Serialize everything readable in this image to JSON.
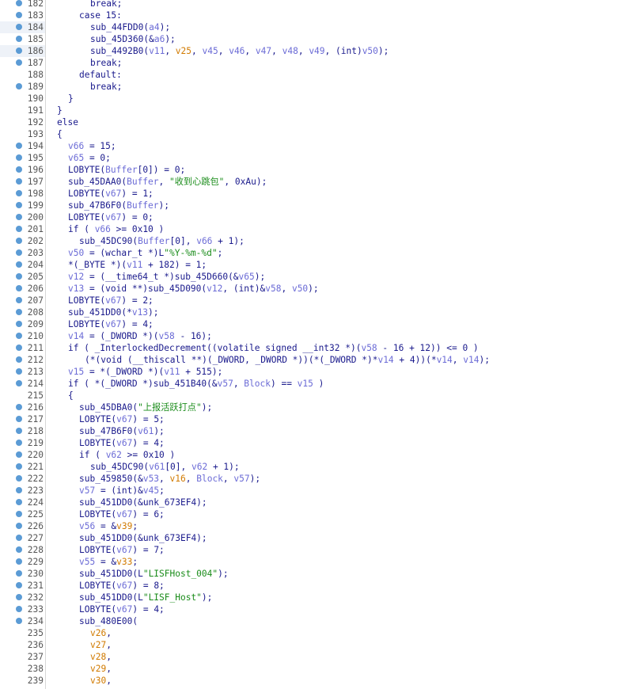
{
  "colors": {
    "default": "#1a1a8c",
    "variable": "#6b6bd6",
    "argument": "#d17a00",
    "string": "#1a8c1a",
    "breakpoint_dot": "#5b9bd5",
    "line_number": "#555555"
  },
  "icons": {
    "line_marker": "breakpoint-dot-icon"
  },
  "highlighted_lines": [
    184,
    186
  ],
  "lines": [
    {
      "n": "182",
      "dot": true,
      "indent": 3,
      "tokens": [
        [
          "break;",
          "d"
        ]
      ]
    },
    {
      "n": "183",
      "dot": true,
      "indent": 2,
      "tokens": [
        [
          "case 15:",
          "d"
        ]
      ]
    },
    {
      "n": "184",
      "dot": true,
      "indent": 3,
      "tokens": [
        [
          "sub_44FDD0(",
          "d"
        ],
        [
          "a4",
          "v"
        ],
        [
          ");",
          "d"
        ]
      ]
    },
    {
      "n": "185",
      "dot": true,
      "indent": 3,
      "tokens": [
        [
          "sub_45D360(&",
          "d"
        ],
        [
          "a6",
          "v"
        ],
        [
          ");",
          "d"
        ]
      ]
    },
    {
      "n": "186",
      "dot": true,
      "indent": 3,
      "tokens": [
        [
          "sub_4492B0(",
          "d"
        ],
        [
          "v11",
          "v"
        ],
        [
          ", ",
          "d"
        ],
        [
          "v25",
          "o"
        ],
        [
          ", ",
          "d"
        ],
        [
          "v45",
          "v"
        ],
        [
          ", ",
          "d"
        ],
        [
          "v46",
          "v"
        ],
        [
          ", ",
          "d"
        ],
        [
          "v47",
          "v"
        ],
        [
          ", ",
          "d"
        ],
        [
          "v48",
          "v"
        ],
        [
          ", ",
          "d"
        ],
        [
          "v49",
          "v"
        ],
        [
          ", (int)",
          "d"
        ],
        [
          "v50",
          "v"
        ],
        [
          ");",
          "d"
        ]
      ]
    },
    {
      "n": "187",
      "dot": true,
      "indent": 3,
      "tokens": [
        [
          "break;",
          "d"
        ]
      ]
    },
    {
      "n": "188",
      "dot": false,
      "indent": 2,
      "tokens": [
        [
          "default:",
          "d"
        ]
      ]
    },
    {
      "n": "189",
      "dot": true,
      "indent": 3,
      "tokens": [
        [
          "break;",
          "d"
        ]
      ]
    },
    {
      "n": "190",
      "dot": false,
      "indent": 1,
      "tokens": [
        [
          "}",
          "d"
        ]
      ]
    },
    {
      "n": "191",
      "dot": false,
      "indent": 0,
      "tokens": [
        [
          "}",
          "d"
        ]
      ]
    },
    {
      "n": "192",
      "dot": false,
      "indent": 0,
      "tokens": [
        [
          "else",
          "d"
        ]
      ]
    },
    {
      "n": "193",
      "dot": false,
      "indent": 0,
      "tokens": [
        [
          "{",
          "d"
        ]
      ]
    },
    {
      "n": "194",
      "dot": true,
      "indent": 1,
      "tokens": [
        [
          "v66",
          "v"
        ],
        [
          " = 15;",
          "d"
        ]
      ]
    },
    {
      "n": "195",
      "dot": true,
      "indent": 1,
      "tokens": [
        [
          "v65",
          "v"
        ],
        [
          " = 0;",
          "d"
        ]
      ]
    },
    {
      "n": "196",
      "dot": true,
      "indent": 1,
      "tokens": [
        [
          "LOBYTE(",
          "d"
        ],
        [
          "Buffer",
          "v"
        ],
        [
          "[0]) = 0;",
          "d"
        ]
      ]
    },
    {
      "n": "197",
      "dot": true,
      "indent": 1,
      "tokens": [
        [
          "sub_45DAA0(",
          "d"
        ],
        [
          "Buffer",
          "v"
        ],
        [
          ", ",
          "d"
        ],
        [
          "\"收到心跳包\"",
          "s"
        ],
        [
          ", 0xAu);",
          "d"
        ]
      ]
    },
    {
      "n": "198",
      "dot": true,
      "indent": 1,
      "tokens": [
        [
          "LOBYTE(",
          "d"
        ],
        [
          "v67",
          "v"
        ],
        [
          ") = 1;",
          "d"
        ]
      ]
    },
    {
      "n": "199",
      "dot": true,
      "indent": 1,
      "tokens": [
        [
          "sub_47B6F0(",
          "d"
        ],
        [
          "Buffer",
          "v"
        ],
        [
          ");",
          "d"
        ]
      ]
    },
    {
      "n": "200",
      "dot": true,
      "indent": 1,
      "tokens": [
        [
          "LOBYTE(",
          "d"
        ],
        [
          "v67",
          "v"
        ],
        [
          ") = 0;",
          "d"
        ]
      ]
    },
    {
      "n": "201",
      "dot": true,
      "indent": 1,
      "tokens": [
        [
          "if ( ",
          "d"
        ],
        [
          "v66",
          "v"
        ],
        [
          " >= 0x10 )",
          "d"
        ]
      ]
    },
    {
      "n": "202",
      "dot": true,
      "indent": 2,
      "tokens": [
        [
          "sub_45DC90(",
          "d"
        ],
        [
          "Buffer",
          "v"
        ],
        [
          "[0], ",
          "d"
        ],
        [
          "v66",
          "v"
        ],
        [
          " + 1);",
          "d"
        ]
      ]
    },
    {
      "n": "203",
      "dot": true,
      "indent": 1,
      "tokens": [
        [
          "v50",
          "v"
        ],
        [
          " = (wchar_t *)L",
          "d"
        ],
        [
          "\"%Y-%m-%d\"",
          "s"
        ],
        [
          ";",
          "d"
        ]
      ]
    },
    {
      "n": "204",
      "dot": true,
      "indent": 1,
      "tokens": [
        [
          "*(_BYTE *)(",
          "d"
        ],
        [
          "v11",
          "v"
        ],
        [
          " + 182) = 1;",
          "d"
        ]
      ]
    },
    {
      "n": "205",
      "dot": true,
      "indent": 1,
      "tokens": [
        [
          "v12",
          "v"
        ],
        [
          " = (__time64_t *)sub_45D660(&",
          "d"
        ],
        [
          "v65",
          "v"
        ],
        [
          ");",
          "d"
        ]
      ]
    },
    {
      "n": "206",
      "dot": true,
      "indent": 1,
      "tokens": [
        [
          "v13",
          "v"
        ],
        [
          " = (void **)sub_45D090(",
          "d"
        ],
        [
          "v12",
          "v"
        ],
        [
          ", (int)&",
          "d"
        ],
        [
          "v58",
          "v"
        ],
        [
          ", ",
          "d"
        ],
        [
          "v50",
          "v"
        ],
        [
          ");",
          "d"
        ]
      ]
    },
    {
      "n": "207",
      "dot": true,
      "indent": 1,
      "tokens": [
        [
          "LOBYTE(",
          "d"
        ],
        [
          "v67",
          "v"
        ],
        [
          ") = 2;",
          "d"
        ]
      ]
    },
    {
      "n": "208",
      "dot": true,
      "indent": 1,
      "tokens": [
        [
          "sub_451DD0(*",
          "d"
        ],
        [
          "v13",
          "v"
        ],
        [
          ");",
          "d"
        ]
      ]
    },
    {
      "n": "209",
      "dot": true,
      "indent": 1,
      "tokens": [
        [
          "LOBYTE(",
          "d"
        ],
        [
          "v67",
          "v"
        ],
        [
          ") = 4;",
          "d"
        ]
      ]
    },
    {
      "n": "210",
      "dot": true,
      "indent": 1,
      "tokens": [
        [
          "v14",
          "v"
        ],
        [
          " = (_DWORD *)(",
          "d"
        ],
        [
          "v58",
          "v"
        ],
        [
          " - 16);",
          "d"
        ]
      ]
    },
    {
      "n": "211",
      "dot": true,
      "indent": 1,
      "tokens": [
        [
          "if ( _InterlockedDecrement((volatile signed __int32 *)(",
          "d"
        ],
        [
          "v58",
          "v"
        ],
        [
          " - 16 + 12)) <= 0 )",
          "d"
        ]
      ]
    },
    {
      "n": "212",
      "dot": true,
      "indent": 2,
      "prefix": " ",
      "tokens": [
        [
          "(*(void (__thiscall **)(_DWORD, _DWORD *))(*(_DWORD *)*",
          "d"
        ],
        [
          "v14",
          "v"
        ],
        [
          " + 4))(*",
          "d"
        ],
        [
          "v14",
          "v"
        ],
        [
          ", ",
          "d"
        ],
        [
          "v14",
          "v"
        ],
        [
          ");",
          "d"
        ]
      ]
    },
    {
      "n": "213",
      "dot": true,
      "indent": 1,
      "tokens": [
        [
          "v15",
          "v"
        ],
        [
          " = *(_DWORD *)(",
          "d"
        ],
        [
          "v11",
          "v"
        ],
        [
          " + 515);",
          "d"
        ]
      ]
    },
    {
      "n": "214",
      "dot": true,
      "indent": 1,
      "tokens": [
        [
          "if ( *(_DWORD *)sub_451B40(&",
          "d"
        ],
        [
          "v57",
          "v"
        ],
        [
          ", ",
          "d"
        ],
        [
          "Block",
          "v"
        ],
        [
          ") == ",
          "d"
        ],
        [
          "v15",
          "v"
        ],
        [
          " )",
          "d"
        ]
      ]
    },
    {
      "n": "215",
      "dot": false,
      "indent": 1,
      "tokens": [
        [
          "{",
          "d"
        ]
      ]
    },
    {
      "n": "216",
      "dot": true,
      "indent": 2,
      "tokens": [
        [
          "sub_45DBA0(",
          "d"
        ],
        [
          "\"上报活跃打点\"",
          "s"
        ],
        [
          ");",
          "d"
        ]
      ]
    },
    {
      "n": "217",
      "dot": true,
      "indent": 2,
      "tokens": [
        [
          "LOBYTE(",
          "d"
        ],
        [
          "v67",
          "v"
        ],
        [
          ") = 5;",
          "d"
        ]
      ]
    },
    {
      "n": "218",
      "dot": true,
      "indent": 2,
      "tokens": [
        [
          "sub_47B6F0(",
          "d"
        ],
        [
          "v61",
          "v"
        ],
        [
          ");",
          "d"
        ]
      ]
    },
    {
      "n": "219",
      "dot": true,
      "indent": 2,
      "tokens": [
        [
          "LOBYTE(",
          "d"
        ],
        [
          "v67",
          "v"
        ],
        [
          ") = 4;",
          "d"
        ]
      ]
    },
    {
      "n": "220",
      "dot": true,
      "indent": 2,
      "tokens": [
        [
          "if ( ",
          "d"
        ],
        [
          "v62",
          "v"
        ],
        [
          " >= 0x10 )",
          "d"
        ]
      ]
    },
    {
      "n": "221",
      "dot": true,
      "indent": 3,
      "tokens": [
        [
          "sub_45DC90(",
          "d"
        ],
        [
          "v61",
          "v"
        ],
        [
          "[0], ",
          "d"
        ],
        [
          "v62",
          "v"
        ],
        [
          " + 1);",
          "d"
        ]
      ]
    },
    {
      "n": "222",
      "dot": true,
      "indent": 2,
      "tokens": [
        [
          "sub_459850(&",
          "d"
        ],
        [
          "v53",
          "v"
        ],
        [
          ", ",
          "d"
        ],
        [
          "v16",
          "o"
        ],
        [
          ", ",
          "d"
        ],
        [
          "Block",
          "v"
        ],
        [
          ", ",
          "d"
        ],
        [
          "v57",
          "v"
        ],
        [
          ");",
          "d"
        ]
      ]
    },
    {
      "n": "223",
      "dot": true,
      "indent": 2,
      "tokens": [
        [
          "v57",
          "v"
        ],
        [
          " = (int)&",
          "d"
        ],
        [
          "v45",
          "v"
        ],
        [
          ";",
          "d"
        ]
      ]
    },
    {
      "n": "224",
      "dot": true,
      "indent": 2,
      "tokens": [
        [
          "sub_451DD0(&unk_673EF4);",
          "d"
        ]
      ]
    },
    {
      "n": "225",
      "dot": true,
      "indent": 2,
      "tokens": [
        [
          "LOBYTE(",
          "d"
        ],
        [
          "v67",
          "v"
        ],
        [
          ") = 6;",
          "d"
        ]
      ]
    },
    {
      "n": "226",
      "dot": true,
      "indent": 2,
      "tokens": [
        [
          "v56",
          "v"
        ],
        [
          " = &",
          "d"
        ],
        [
          "v39",
          "o"
        ],
        [
          ";",
          "d"
        ]
      ]
    },
    {
      "n": "227",
      "dot": true,
      "indent": 2,
      "tokens": [
        [
          "sub_451DD0(&unk_673EF4);",
          "d"
        ]
      ]
    },
    {
      "n": "228",
      "dot": true,
      "indent": 2,
      "tokens": [
        [
          "LOBYTE(",
          "d"
        ],
        [
          "v67",
          "v"
        ],
        [
          ") = 7;",
          "d"
        ]
      ]
    },
    {
      "n": "229",
      "dot": true,
      "indent": 2,
      "tokens": [
        [
          "v55",
          "v"
        ],
        [
          " = &",
          "d"
        ],
        [
          "v33",
          "o"
        ],
        [
          ";",
          "d"
        ]
      ]
    },
    {
      "n": "230",
      "dot": true,
      "indent": 2,
      "tokens": [
        [
          "sub_451DD0(L",
          "d"
        ],
        [
          "\"LISFHost_004\"",
          "s"
        ],
        [
          ");",
          "d"
        ]
      ]
    },
    {
      "n": "231",
      "dot": true,
      "indent": 2,
      "tokens": [
        [
          "LOBYTE(",
          "d"
        ],
        [
          "v67",
          "v"
        ],
        [
          ") = 8;",
          "d"
        ]
      ]
    },
    {
      "n": "232",
      "dot": true,
      "indent": 2,
      "tokens": [
        [
          "sub_451DD0(L",
          "d"
        ],
        [
          "\"LISF_Host\"",
          "s"
        ],
        [
          ");",
          "d"
        ]
      ]
    },
    {
      "n": "233",
      "dot": true,
      "indent": 2,
      "tokens": [
        [
          "LOBYTE(",
          "d"
        ],
        [
          "v67",
          "v"
        ],
        [
          ") = 4;",
          "d"
        ]
      ]
    },
    {
      "n": "234",
      "dot": true,
      "indent": 2,
      "tokens": [
        [
          "sub_480E00(",
          "d"
        ]
      ]
    },
    {
      "n": "235",
      "dot": false,
      "indent": 3,
      "tokens": [
        [
          "v26",
          "o"
        ],
        [
          ",",
          "d"
        ]
      ]
    },
    {
      "n": "236",
      "dot": false,
      "indent": 3,
      "tokens": [
        [
          "v27",
          "o"
        ],
        [
          ",",
          "d"
        ]
      ]
    },
    {
      "n": "237",
      "dot": false,
      "indent": 3,
      "tokens": [
        [
          "v28",
          "o"
        ],
        [
          ",",
          "d"
        ]
      ]
    },
    {
      "n": "238",
      "dot": false,
      "indent": 3,
      "tokens": [
        [
          "v29",
          "o"
        ],
        [
          ",",
          "d"
        ]
      ]
    },
    {
      "n": "239",
      "dot": false,
      "indent": 3,
      "tokens": [
        [
          "v30",
          "o"
        ],
        [
          ",",
          "d"
        ]
      ]
    }
  ]
}
